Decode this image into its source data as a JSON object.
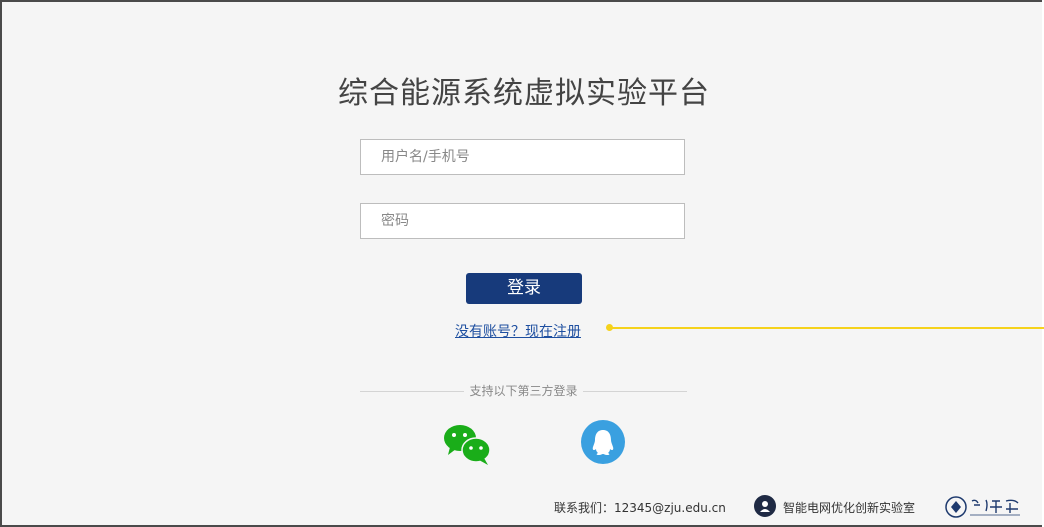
{
  "page": {
    "title": "综合能源系统虚拟实验平台"
  },
  "login_form": {
    "username_placeholder": "用户名/手机号",
    "password_placeholder": "密码",
    "login_label": "登录",
    "register_link": "没有账号？现在注册"
  },
  "third_party": {
    "divider_text": "支持以下第三方登录",
    "providers": [
      {
        "name": "wechat",
        "icon": "wechat-icon",
        "color": "#1aad19"
      },
      {
        "name": "qq",
        "icon": "qq-penguin-icon",
        "color": "#3aa0e0"
      }
    ]
  },
  "footer": {
    "contact": "联系我们：12345@zju.edu.cn",
    "lab_name": "智能电网优化创新实验室",
    "university_logo_text": "浙江大学"
  },
  "colors": {
    "background": "#f5f5f5",
    "primary": "#173a7b",
    "link": "#1e4fa0",
    "callout": "#f5d21c",
    "wechat": "#1aad19",
    "qq": "#3aa0e0"
  }
}
